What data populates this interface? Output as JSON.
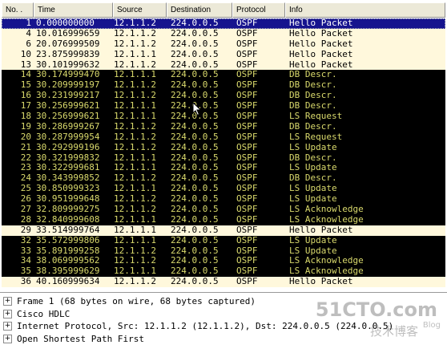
{
  "columns": {
    "no": "No. .",
    "time": "Time",
    "source": "Source",
    "destination": "Destination",
    "protocol": "Protocol",
    "info": "Info"
  },
  "packets": [
    {
      "no": "1",
      "time": "0.000000000",
      "src": "12.1.1.2",
      "dst": "224.0.0.5",
      "proto": "OSPF",
      "info": "Hello Packet",
      "style": "sel"
    },
    {
      "no": "4",
      "time": "10.016999659",
      "src": "12.1.1.2",
      "dst": "224.0.0.5",
      "proto": "OSPF",
      "info": "Hello Packet",
      "style": "hello"
    },
    {
      "no": "6",
      "time": "20.076999509",
      "src": "12.1.1.2",
      "dst": "224.0.0.5",
      "proto": "OSPF",
      "info": "Hello Packet",
      "style": "hello"
    },
    {
      "no": "10",
      "time": "23.875999839",
      "src": "12.1.1.1",
      "dst": "224.0.0.5",
      "proto": "OSPF",
      "info": "Hello Packet",
      "style": "hello"
    },
    {
      "no": "13",
      "time": "30.101999632",
      "src": "12.1.1.2",
      "dst": "224.0.0.5",
      "proto": "OSPF",
      "info": "Hello Packet",
      "style": "hello"
    },
    {
      "no": "14",
      "time": "30.174999470",
      "src": "12.1.1.1",
      "dst": "224.0.0.5",
      "proto": "OSPF",
      "info": "DB Descr.",
      "style": "dark"
    },
    {
      "no": "15",
      "time": "30.209999197",
      "src": "12.1.1.2",
      "dst": "224.0.0.5",
      "proto": "OSPF",
      "info": "DB Descr.",
      "style": "dark"
    },
    {
      "no": "16",
      "time": "30.231999217",
      "src": "12.1.1.2",
      "dst": "224.0.0.5",
      "proto": "OSPF",
      "info": "DB Descr.",
      "style": "dark"
    },
    {
      "no": "17",
      "time": "30.256999621",
      "src": "12.1.1.1",
      "dst": "224.0.0.5",
      "proto": "OSPF",
      "info": "DB Descr.",
      "style": "dark"
    },
    {
      "no": "18",
      "time": "30.256999621",
      "src": "12.1.1.1",
      "dst": "224.0.0.5",
      "proto": "OSPF",
      "info": "LS Request",
      "style": "dark"
    },
    {
      "no": "19",
      "time": "30.286999267",
      "src": "12.1.1.2",
      "dst": "224.0.0.5",
      "proto": "OSPF",
      "info": "DB Descr.",
      "style": "dark"
    },
    {
      "no": "20",
      "time": "30.287999954",
      "src": "12.1.1.2",
      "dst": "224.0.0.5",
      "proto": "OSPF",
      "info": "LS Request",
      "style": "dark"
    },
    {
      "no": "21",
      "time": "30.292999196",
      "src": "12.1.1.2",
      "dst": "224.0.0.5",
      "proto": "OSPF",
      "info": "LS Update",
      "style": "dark"
    },
    {
      "no": "22",
      "time": "30.321999832",
      "src": "12.1.1.1",
      "dst": "224.0.0.5",
      "proto": "OSPF",
      "info": "DB Descr.",
      "style": "dark"
    },
    {
      "no": "23",
      "time": "30.322999681",
      "src": "12.1.1.1",
      "dst": "224.0.0.5",
      "proto": "OSPF",
      "info": "LS Update",
      "style": "dark"
    },
    {
      "no": "24",
      "time": "30.343999852",
      "src": "12.1.1.2",
      "dst": "224.0.0.5",
      "proto": "OSPF",
      "info": "DB Descr.",
      "style": "dark"
    },
    {
      "no": "25",
      "time": "30.850999323",
      "src": "12.1.1.1",
      "dst": "224.0.0.5",
      "proto": "OSPF",
      "info": "LS Update",
      "style": "dark"
    },
    {
      "no": "26",
      "time": "30.951999648",
      "src": "12.1.1.2",
      "dst": "224.0.0.5",
      "proto": "OSPF",
      "info": "LS Update",
      "style": "dark"
    },
    {
      "no": "27",
      "time": "32.809999275",
      "src": "12.1.1.2",
      "dst": "224.0.0.5",
      "proto": "OSPF",
      "info": "LS Acknowledge",
      "style": "dark"
    },
    {
      "no": "28",
      "time": "32.840999608",
      "src": "12.1.1.1",
      "dst": "224.0.0.5",
      "proto": "OSPF",
      "info": "LS Acknowledge",
      "style": "dark"
    },
    {
      "no": "29",
      "time": "33.514999764",
      "src": "12.1.1.1",
      "dst": "224.0.0.5",
      "proto": "OSPF",
      "info": "Hello Packet",
      "style": "hello"
    },
    {
      "no": "32",
      "time": "35.572999806",
      "src": "12.1.1.1",
      "dst": "224.0.0.5",
      "proto": "OSPF",
      "info": "LS Update",
      "style": "dark"
    },
    {
      "no": "33",
      "time": "35.891999258",
      "src": "12.1.1.2",
      "dst": "224.0.0.5",
      "proto": "OSPF",
      "info": "LS Update",
      "style": "dark"
    },
    {
      "no": "34",
      "time": "38.069999562",
      "src": "12.1.1.2",
      "dst": "224.0.0.5",
      "proto": "OSPF",
      "info": "LS Acknowledge",
      "style": "dark"
    },
    {
      "no": "35",
      "time": "38.395999629",
      "src": "12.1.1.1",
      "dst": "224.0.0.5",
      "proto": "OSPF",
      "info": "LS Acknowledge",
      "style": "dark"
    },
    {
      "no": "36",
      "time": "40.160999634",
      "src": "12.1.1.2",
      "dst": "224.0.0.5",
      "proto": "OSPF",
      "info": "Hello Packet",
      "style": "hello"
    }
  ],
  "details": [
    {
      "expand": "+",
      "text": "Frame 1 (68 bytes on wire, 68 bytes captured)"
    },
    {
      "expand": "+",
      "text": "Cisco HDLC"
    },
    {
      "expand": "+",
      "text": "Internet Protocol, Src: 12.1.1.2 (12.1.1.2), Dst: 224.0.0.5 (224.0.0.5)"
    },
    {
      "expand": "+",
      "text": "Open Shortest Path First"
    }
  ],
  "watermark": {
    "logo": "51CTO.com",
    "subtitle": "技术博客",
    "blog": "Blog"
  },
  "colors": {
    "selected_bg": "#16148e",
    "hello_bg": "#fff8dc",
    "dark_bg": "#000000",
    "dark_fg": "#d9d96c"
  }
}
